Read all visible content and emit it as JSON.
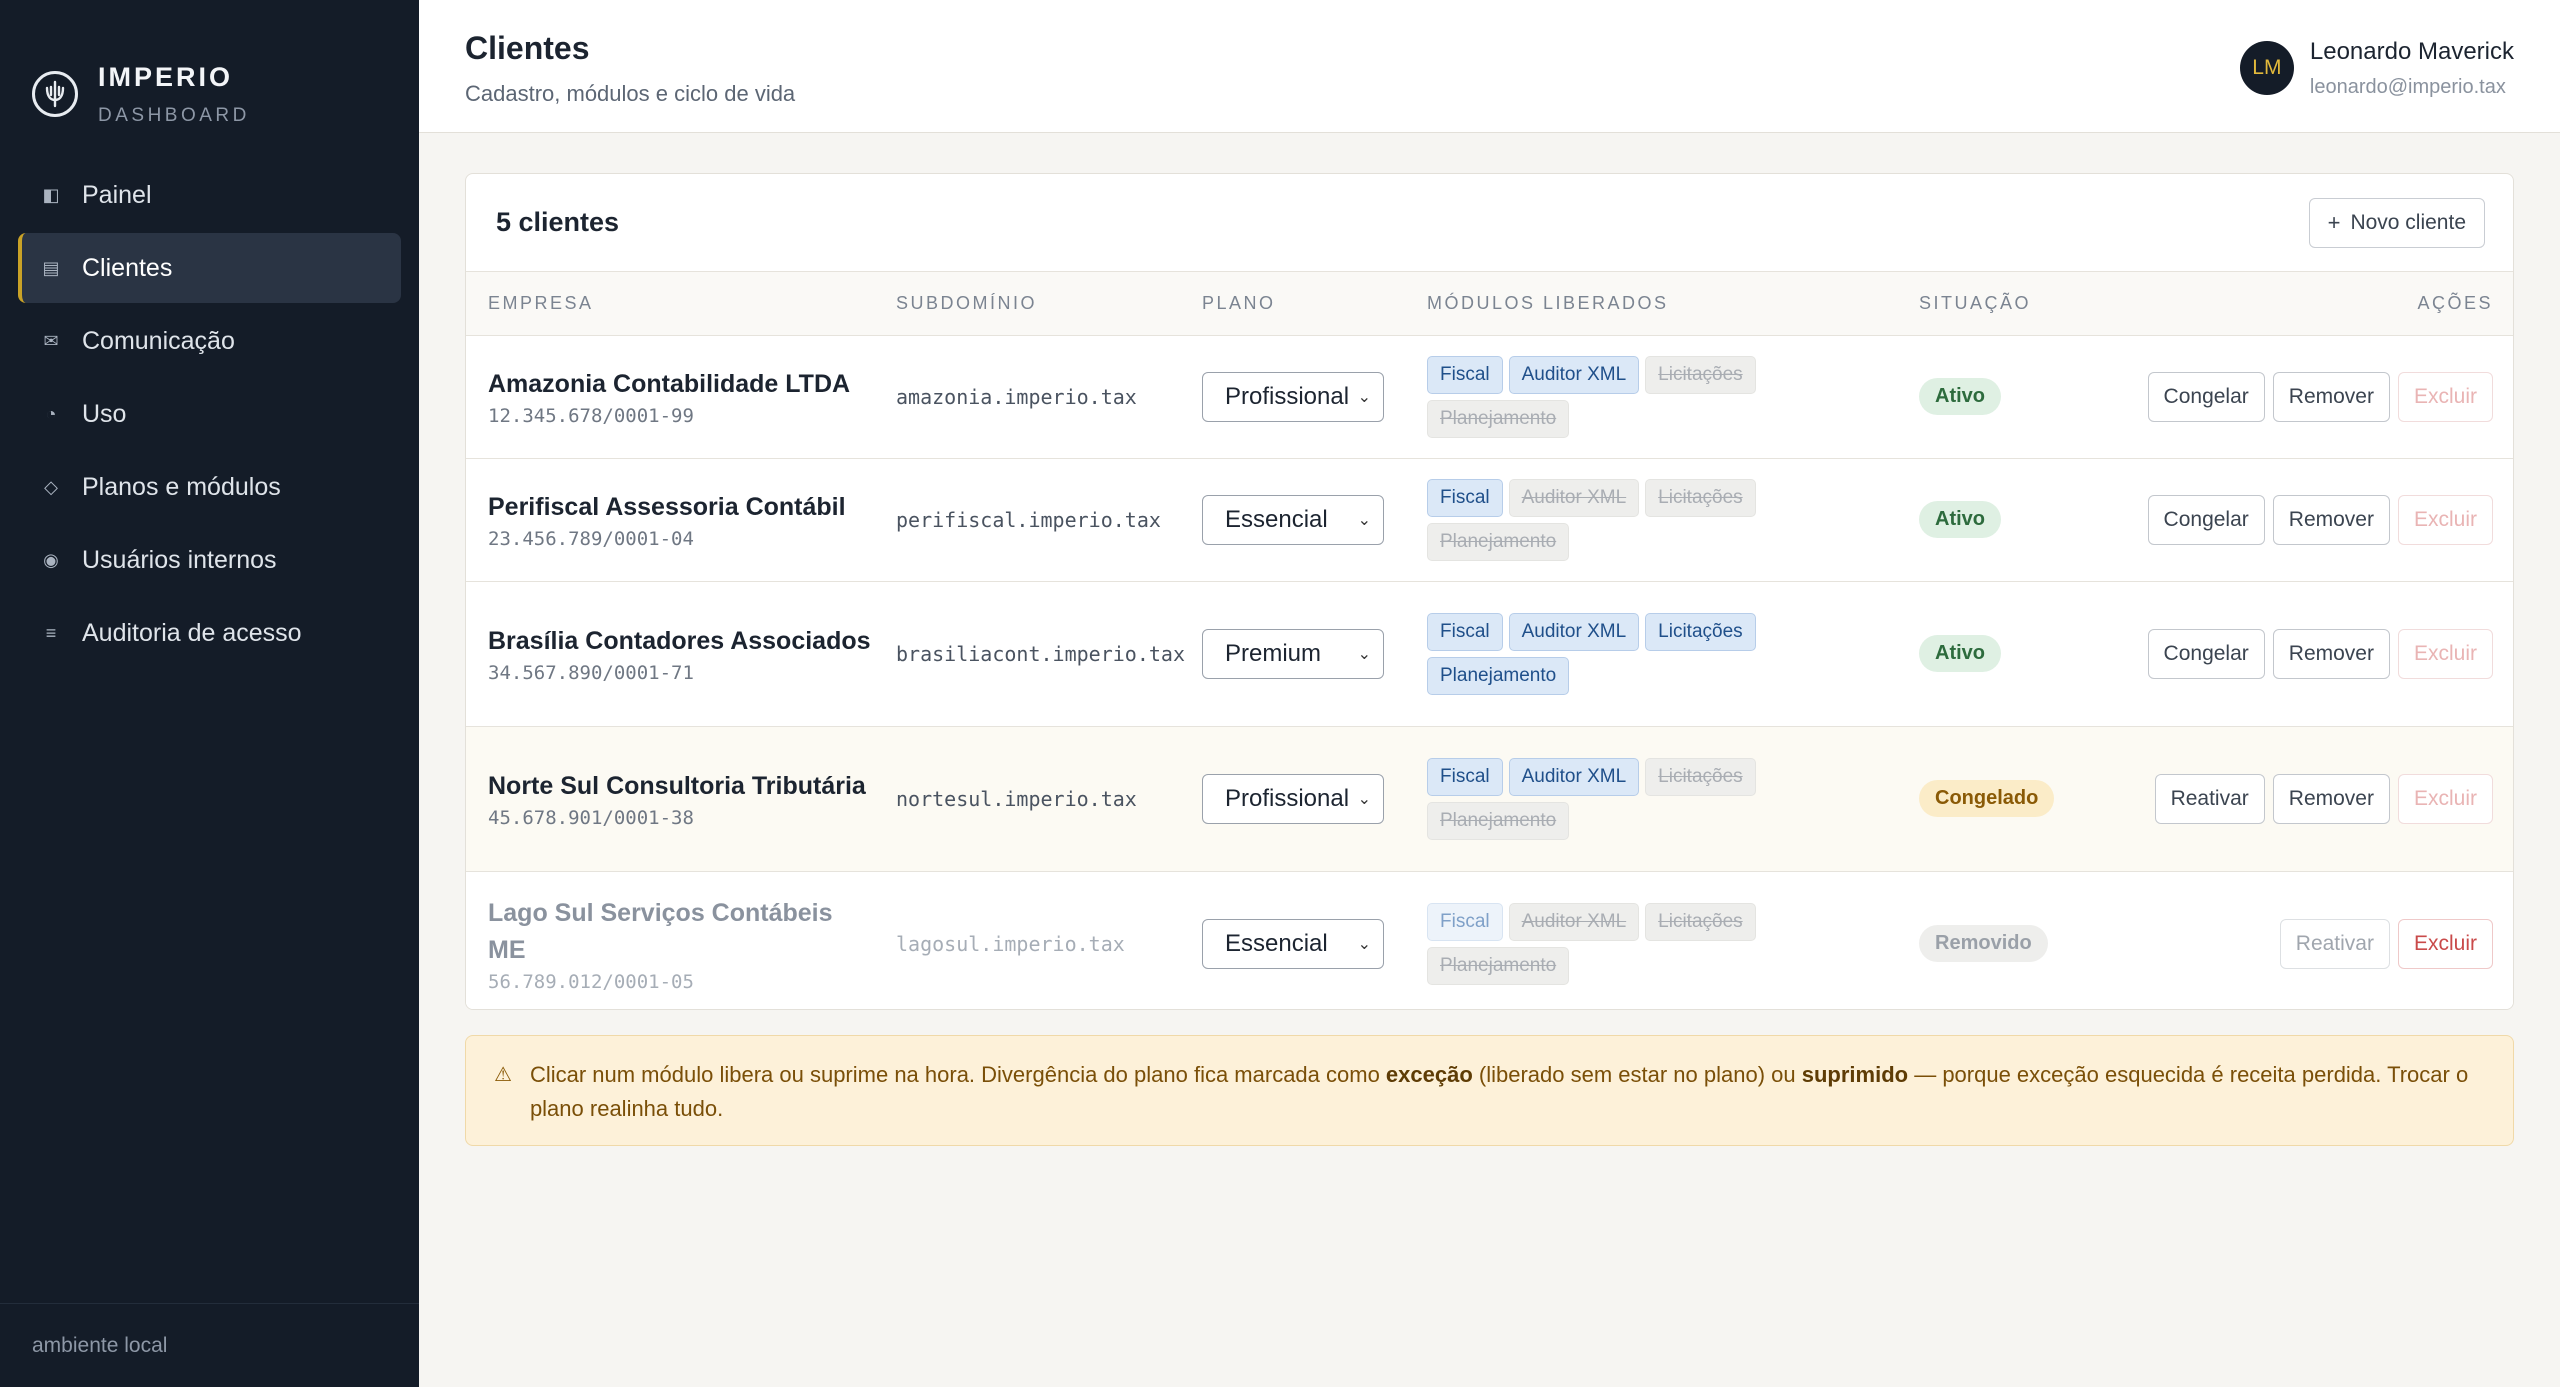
{
  "brand": {
    "name": "IMPERIO",
    "sub": "DASHBOARD"
  },
  "sidebar": {
    "items": [
      {
        "label": "Painel",
        "icon": "panel-icon",
        "glyph": "◧"
      },
      {
        "label": "Clientes",
        "icon": "clients-icon",
        "glyph": "▤",
        "active": true
      },
      {
        "label": "Comunicação",
        "icon": "mail-icon",
        "glyph": "✉"
      },
      {
        "label": "Uso",
        "icon": "pie-icon",
        "glyph": "◔"
      },
      {
        "label": "Planos e módulos",
        "icon": "diamond-icon",
        "glyph": "◇"
      },
      {
        "label": "Usuários internos",
        "icon": "user-dot-icon",
        "glyph": "◉"
      },
      {
        "label": "Auditoria de acesso",
        "icon": "list-icon",
        "glyph": "≡"
      }
    ],
    "footer": "ambiente local"
  },
  "header": {
    "title": "Clientes",
    "subtitle": "Cadastro, módulos e ciclo de vida",
    "user": {
      "initials": "LM",
      "name": "Leonardo Maverick",
      "email": "leonardo@imperio.tax"
    }
  },
  "card": {
    "title": "5 clientes",
    "new_button": "Novo cliente",
    "columns": [
      "EMPRESA",
      "SUBDOMÍNIO",
      "PLANO",
      "MÓDULOS LIBERADOS",
      "SITUAÇÃO",
      "AÇÕES"
    ]
  },
  "rows": [
    {
      "name": "Amazonia Contabilidade LTDA",
      "cnpj": "12.345.678/0001-99",
      "subdomain": "amazonia.imperio.tax",
      "plan": "Profissional",
      "modules": [
        {
          "label": "Fiscal",
          "on": true
        },
        {
          "label": "Auditor XML",
          "on": true
        },
        {
          "label": "Licitações",
          "on": false
        },
        {
          "label": "Planejamento",
          "on": false
        }
      ],
      "status": "Ativo",
      "status_kind": "ativo",
      "actions": [
        {
          "label": "Congelar",
          "kind": ""
        },
        {
          "label": "Remover",
          "kind": ""
        },
        {
          "label": "Excluir",
          "kind": "danger-dim"
        }
      ]
    },
    {
      "name": "Perifiscal Assessoria Contábil",
      "cnpj": "23.456.789/0001-04",
      "subdomain": "perifiscal.imperio.tax",
      "plan": "Essencial",
      "modules": [
        {
          "label": "Fiscal",
          "on": true
        },
        {
          "label": "Auditor XML",
          "on": false
        },
        {
          "label": "Licitações",
          "on": false
        },
        {
          "label": "Planejamento",
          "on": false
        }
      ],
      "status": "Ativo",
      "status_kind": "ativo",
      "actions": [
        {
          "label": "Congelar",
          "kind": ""
        },
        {
          "label": "Remover",
          "kind": ""
        },
        {
          "label": "Excluir",
          "kind": "danger-dim"
        }
      ]
    },
    {
      "name": "Brasília Contadores Associados",
      "cnpj": "34.567.890/0001-71",
      "subdomain": "brasiliacont.imperio.tax",
      "plan": "Premium",
      "modules": [
        {
          "label": "Fiscal",
          "on": true
        },
        {
          "label": "Auditor XML",
          "on": true
        },
        {
          "label": "Licitações",
          "on": true
        },
        {
          "label": "Planejamento",
          "on": true
        }
      ],
      "status": "Ativo",
      "status_kind": "ativo",
      "actions": [
        {
          "label": "Congelar",
          "kind": ""
        },
        {
          "label": "Remover",
          "kind": ""
        },
        {
          "label": "Excluir",
          "kind": "danger-dim"
        }
      ]
    },
    {
      "name": "Norte Sul Consultoria Tributária",
      "cnpj": "45.678.901/0001-38",
      "subdomain": "nortesul.imperio.tax",
      "plan": "Profissional",
      "modules": [
        {
          "label": "Fiscal",
          "on": true
        },
        {
          "label": "Auditor XML",
          "on": true
        },
        {
          "label": "Licitações",
          "on": false
        },
        {
          "label": "Planejamento",
          "on": false
        }
      ],
      "status": "Congelado",
      "status_kind": "congelado",
      "actions": [
        {
          "label": "Reativar",
          "kind": ""
        },
        {
          "label": "Remover",
          "kind": ""
        },
        {
          "label": "Excluir",
          "kind": "danger-dim"
        }
      ]
    },
    {
      "name": "Lago Sul Serviços Contábeis ME",
      "cnpj": "56.789.012/0001-05",
      "subdomain": "lagosul.imperio.tax",
      "plan": "Essencial",
      "modules": [
        {
          "label": "Fiscal",
          "on": true
        },
        {
          "label": "Auditor XML",
          "on": false
        },
        {
          "label": "Licitações",
          "on": false
        },
        {
          "label": "Planejamento",
          "on": false
        }
      ],
      "status": "Removido",
      "status_kind": "removido",
      "actions": [
        {
          "label": "Reativar",
          "kind": "dim"
        },
        {
          "label": "Excluir",
          "kind": "danger"
        }
      ]
    }
  ],
  "notice": {
    "icon": "warning-icon",
    "before": "Clicar num módulo libera ou suprime na hora. Divergência do plano fica marcada como ",
    "bold1": "exceção",
    "middle": " (liberado sem estar no plano) ou ",
    "bold2": "suprimido",
    "after": " — porque exceção esquecida é receita perdida. Trocar o plano realinha tudo."
  },
  "colors": {
    "sidebar_bg": "#141c28",
    "accent": "#c9a227",
    "module_on": "#dbe8f7",
    "status_active": "#dff0e3",
    "status_frozen": "#fbecc8"
  }
}
